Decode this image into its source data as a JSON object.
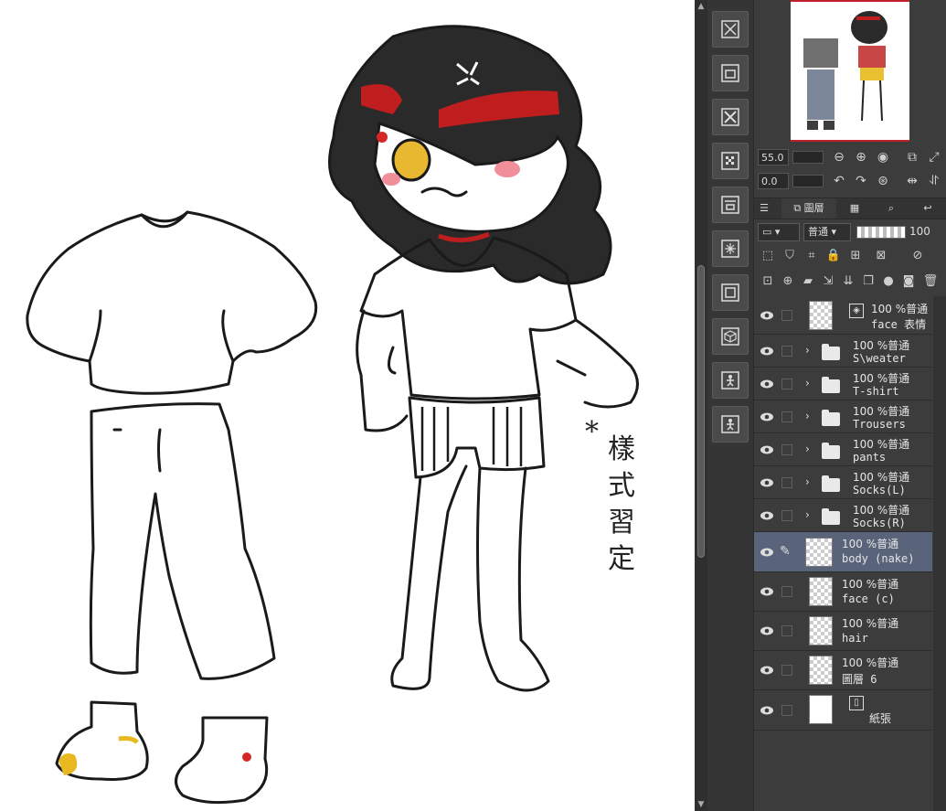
{
  "canvas": {
    "annotation_mark": "*",
    "annotation_text": "樣式習定"
  },
  "navigator": {
    "zoom_value": "55.0",
    "rotate_value": "0.0"
  },
  "layer_panel": {
    "tab_label": "圖層",
    "blend_mode": "普通",
    "opacity": "100",
    "layers": [
      {
        "id": "face-expression",
        "pct": "100 %普通",
        "name": "face 表情",
        "kind": "object",
        "visible": true
      },
      {
        "id": "sweater",
        "pct": "100 %普通",
        "name": "S\\weater",
        "kind": "folder",
        "visible": true
      },
      {
        "id": "tshirt",
        "pct": "100 %普通",
        "name": "T-shirt",
        "kind": "folder",
        "visible": true
      },
      {
        "id": "trousers",
        "pct": "100 %普通",
        "name": "Trousers",
        "kind": "folder",
        "visible": true
      },
      {
        "id": "pants",
        "pct": "100 %普通",
        "name": "pants",
        "kind": "folder",
        "visible": true
      },
      {
        "id": "socks-l",
        "pct": "100 %普通",
        "name": "Socks(L)",
        "kind": "folder",
        "visible": true
      },
      {
        "id": "socks-r",
        "pct": "100 %普通",
        "name": "Socks(R)",
        "kind": "folder",
        "visible": true
      },
      {
        "id": "body",
        "pct": "100 %普通",
        "name": "body (nake)",
        "kind": "raster",
        "visible": true,
        "selected": true
      },
      {
        "id": "face-c",
        "pct": "100 %普通",
        "name": "face (c)",
        "kind": "raster",
        "visible": true
      },
      {
        "id": "hair",
        "pct": "100 %普通",
        "name": "hair",
        "kind": "raster",
        "visible": true
      },
      {
        "id": "layer6",
        "pct": "100 %普通",
        "name": "圖層 6",
        "kind": "raster",
        "visible": true
      },
      {
        "id": "paper",
        "pct": "",
        "name": "紙張",
        "kind": "paper",
        "visible": true
      }
    ]
  },
  "colors": {
    "selected_layer": "#59647a",
    "accent_red": "#c0202a",
    "panel_bg": "#3c3c3c"
  }
}
